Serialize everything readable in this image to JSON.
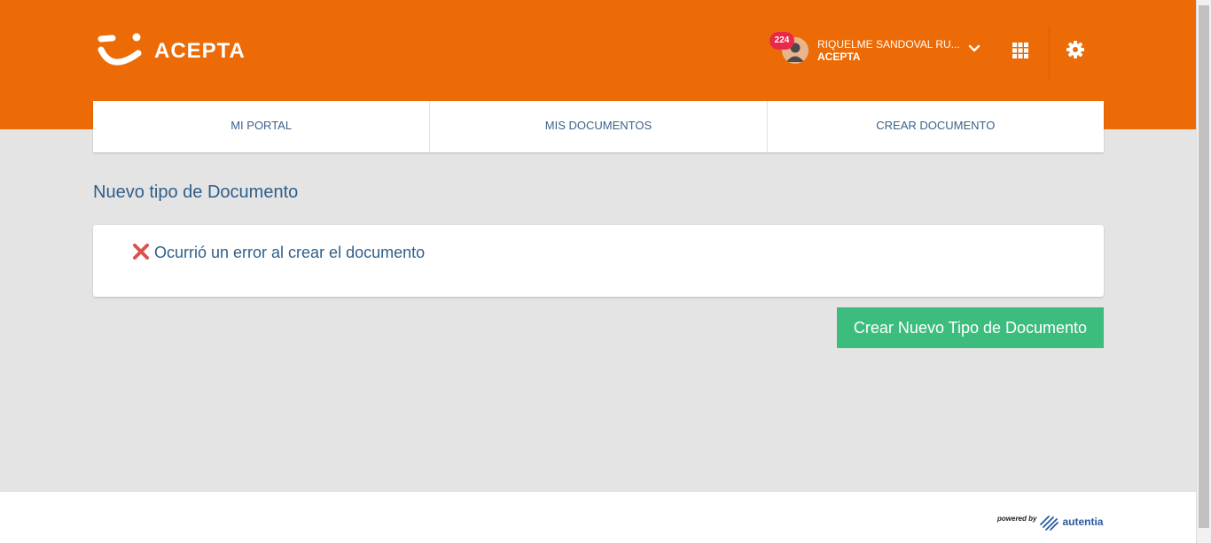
{
  "header": {
    "brand": "ACEPTA",
    "notifications_count": "224",
    "user_name": "RIQUELME SANDOVAL RU...",
    "user_org": "ACEPTA"
  },
  "nav": {
    "items": [
      {
        "label": "MI PORTAL"
      },
      {
        "label": "MIS DOCUMENTOS"
      },
      {
        "label": "CREAR DOCUMENTO"
      }
    ]
  },
  "main": {
    "title": "Nuevo tipo de Documento",
    "error_message": "Ocurrió un error al crear el documento",
    "create_button_label": "Crear Nuevo Tipo de Documento"
  },
  "footer": {
    "powered_by": "powered by",
    "powered_name": "autentia"
  },
  "icons": {
    "logo": "smile-logo-icon",
    "avatar": "user-avatar-icon",
    "chevron": "chevron-down-icon",
    "apps": "grid-apps-icon",
    "settings": "gear-icon",
    "error": "x-mark-icon"
  },
  "colors": {
    "brand_orange": "#ec6b06",
    "background": "#e4e4e4",
    "text_blue": "#2f5f89",
    "button_green": "#3dbd7d",
    "badge_red": "#e8294a",
    "error_red": "#d9534f"
  }
}
